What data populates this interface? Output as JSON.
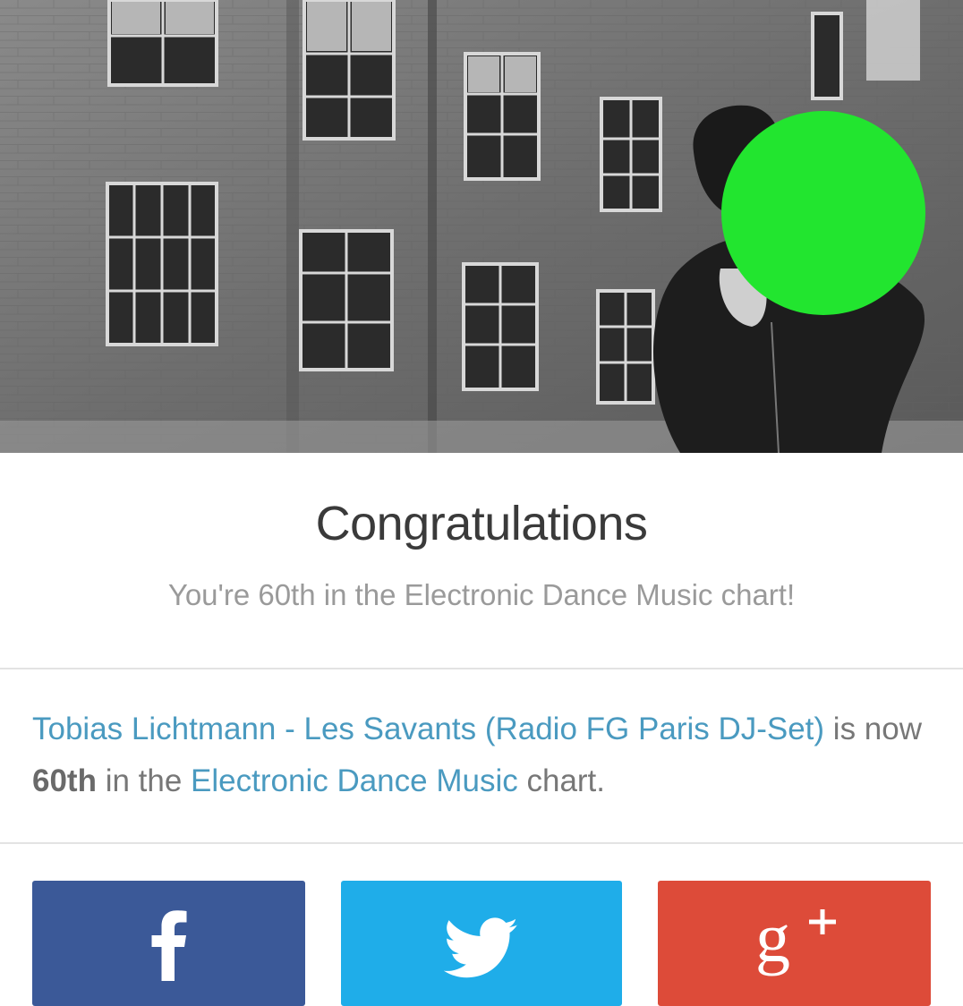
{
  "hero": {
    "image_description": "black-and-white photo of a person in front of a weathered building",
    "face_overlay_color": "#22e52f"
  },
  "congrats": {
    "title": "Congratulations",
    "subtitle": "You're 60th in the Electronic Dance Music chart!"
  },
  "message": {
    "track_link": "Tobias Lichtmann - Les Savants (Radio FG Paris DJ-Set)",
    "text_is_now": " is now",
    "rank": "60th",
    "text_in_the": " in the ",
    "chart_link": "Electronic Dance Music",
    "text_chart": " chart."
  },
  "share": {
    "facebook": {
      "icon": "facebook-icon",
      "color": "#3b5998"
    },
    "twitter": {
      "icon": "twitter-icon",
      "color": "#1fade9"
    },
    "googleplus": {
      "icon": "google-plus-icon",
      "color": "#dd4b39"
    }
  },
  "colors": {
    "link": "#4a9ac0",
    "title": "#3a3a3a",
    "subtitle": "#9a9a9a",
    "body": "#777777"
  }
}
